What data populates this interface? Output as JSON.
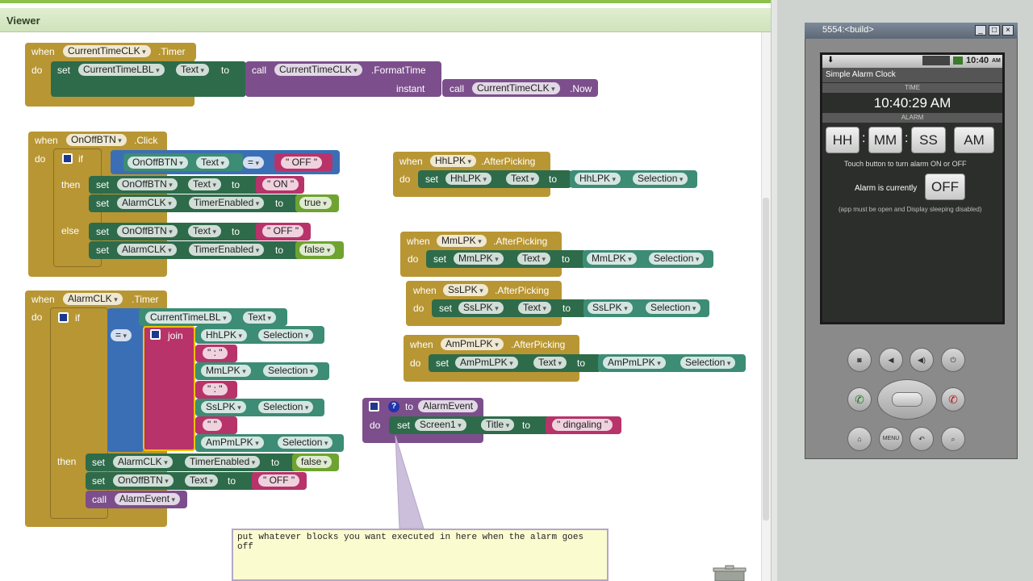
{
  "editor": {
    "title": "Viewer",
    "comment": "put whatever blocks you want executed in here when the alarm goes off"
  },
  "kw": {
    "when": "when",
    "do": "do",
    "set": "set",
    "to": "to",
    "call": "call",
    "if": "if",
    "then": "then",
    "else": "else",
    "join": "join",
    "instant": "instant",
    "eq": "="
  },
  "b1": {
    "comp": "CurrentTimeCLK",
    "event": ".Timer",
    "lbl": "CurrentTimeLBL",
    "prop": "Text",
    "clk": "CurrentTimeCLK",
    "fn": ".FormatTime",
    "clk2": "CurrentTimeCLK",
    "now": ".Now"
  },
  "b2": {
    "comp": "OnOffBTN",
    "event": ".Click",
    "cond_comp": "OnOffBTN",
    "cond_prop": "Text",
    "off": "\" OFF \"",
    "t1c": "OnOffBTN",
    "t1p": "Text",
    "on": "\" ON \"",
    "t2c": "AlarmCLK",
    "t2p": "TimerEnabled",
    "true": "true",
    "e1c": "OnOffBTN",
    "e1p": "Text",
    "off2": "\" OFF \"",
    "e2c": "AlarmCLK",
    "e2p": "TimerEnabled",
    "false": "false"
  },
  "b3": {
    "comp": "AlarmCLK",
    "event": ".Timer",
    "lbl": "CurrentTimeLBL",
    "prop": "Text",
    "j1": "HhLPK",
    "j2": "MmLPK",
    "j3": "SsLPK",
    "j4": "AmPmLPK",
    "sel": "Selection",
    "sep": "\" : \"",
    "sp": "\" \"",
    "s1c": "AlarmCLK",
    "s1p": "TimerEnabled",
    "false": "false",
    "s2c": "OnOffBTN",
    "s2p": "Text",
    "off": "\" OFF \"",
    "callp": "AlarmEvent"
  },
  "pickers": [
    {
      "comp": "HhLPK",
      "event": ".AfterPicking",
      "c": "HhLPK",
      "p": "Text",
      "v": "HhLPK",
      "s": "Selection"
    },
    {
      "comp": "MmLPK",
      "event": ".AfterPicking",
      "c": "MmLPK",
      "p": "Text",
      "v": "MmLPK",
      "s": "Selection"
    },
    {
      "comp": "SsLPK",
      "event": ".AfterPicking",
      "c": "SsLPK",
      "p": "Text",
      "v": "SsLPK",
      "s": "Selection"
    },
    {
      "comp": "AmPmLPK",
      "event": ".AfterPicking",
      "c": "AmPmLPK",
      "p": "Text",
      "v": "AmPmLPK",
      "s": "Selection"
    }
  ],
  "proc": {
    "name": "AlarmEvent",
    "comp": "Screen1",
    "prop": "Title",
    "val": "\" dingaling \"",
    "q": "?"
  },
  "emulator": {
    "window_title": "5554:<build>",
    "status_time": "10:40",
    "status_ampm": "AM",
    "app_title": "Simple Alarm Clock",
    "time_header": "TIME",
    "current_time": "10:40:29 AM",
    "alarm_header": "ALARM",
    "hh": "HH",
    "mm": "MM",
    "ss": "SS",
    "ampm": "AM",
    "colon": ":",
    "hint": "Touch button to turn alarm ON or OFF",
    "alarm_label": "Alarm is currently",
    "alarm_state": "OFF",
    "note": "(app must be open and Display sleeping disabled)",
    "menu_label": "MENU"
  },
  "colors": {
    "event": "#b89633",
    "setter": "#2e6b4a",
    "getter": "#3d8c75",
    "procedure": "#7c4f8c",
    "logic": "#3b6fb5",
    "text": "#b8336a",
    "boolean": "#6fa331"
  }
}
